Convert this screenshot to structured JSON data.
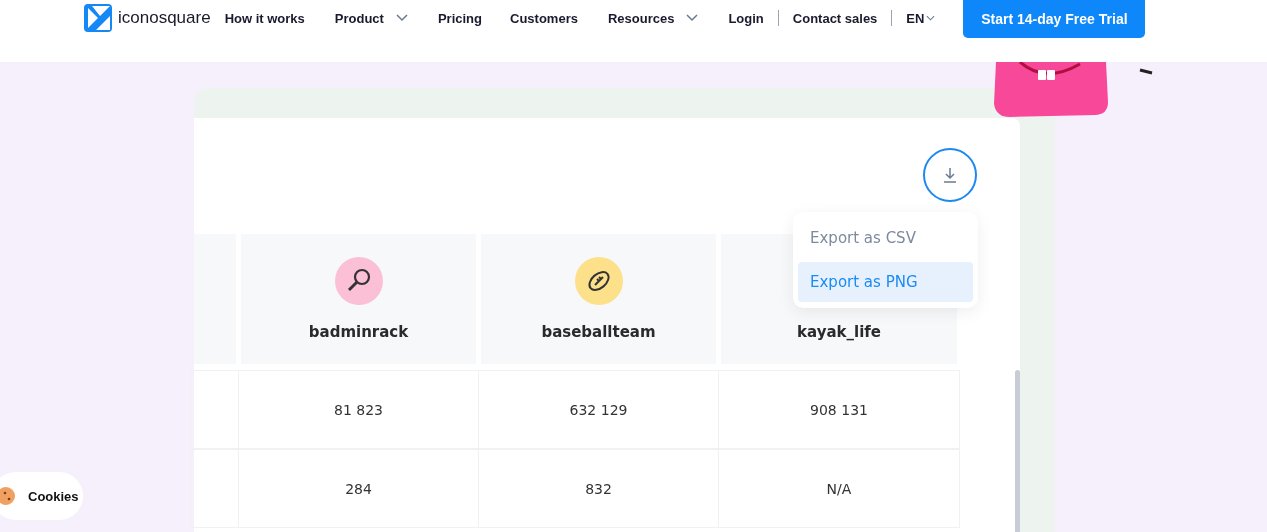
{
  "nav": {
    "logo": "iconosquare",
    "items": [
      {
        "label": "How it works",
        "caret": false
      },
      {
        "label": "Product",
        "caret": true
      },
      {
        "label": "Pricing",
        "caret": false
      },
      {
        "label": "Customers",
        "caret": false
      },
      {
        "label": "Resources",
        "caret": true
      }
    ],
    "login": "Login",
    "contact": "Contact sales",
    "language": "EN",
    "cta": "Start 14-day Free Trial"
  },
  "export_menu": {
    "items": [
      {
        "label": "Export as CSV",
        "selected": false
      },
      {
        "label": "Export as PNG",
        "selected": true
      }
    ]
  },
  "table": {
    "columns": [
      {
        "name": "badminrack",
        "kind": "racket",
        "color": "#fbbfd6"
      },
      {
        "name": "baseballteam",
        "kind": "ball",
        "color": "#fde08a"
      },
      {
        "name": "kayak_life"
      }
    ],
    "rows": [
      {
        "cells": [
          "81 823",
          "632 129",
          "908 131"
        ]
      },
      {
        "cells": [
          "284",
          "832",
          "N/A"
        ]
      }
    ]
  },
  "cookies": {
    "label": "Cookies"
  }
}
